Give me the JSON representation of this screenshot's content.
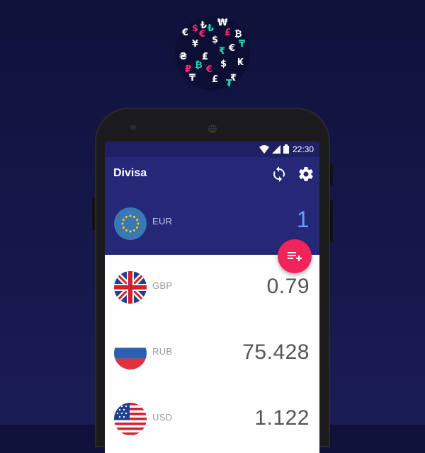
{
  "status_bar": {
    "time": "22:30"
  },
  "app": {
    "title": "Divisa"
  },
  "icons": {
    "logo": "currency-symbols-logo",
    "refresh": "sync-icon",
    "settings": "gear-icon",
    "fab": "add-to-list-icon"
  },
  "currencies": [
    {
      "code": "EUR",
      "value": "1",
      "flag": "eu-flag",
      "is_base": true
    },
    {
      "code": "GBP",
      "value": "0.79",
      "flag": "uk-flag",
      "is_base": false
    },
    {
      "code": "RUB",
      "value": "75.428",
      "flag": "russia-flag",
      "is_base": false
    },
    {
      "code": "USD",
      "value": "1.122",
      "flag": "usa-flag",
      "is_base": false
    }
  ],
  "colors": {
    "primary": "#252876",
    "primary_dark": "#1e1f65",
    "accent": "#f0245a",
    "base_value": "#5ea0ff",
    "background": "#151749"
  }
}
